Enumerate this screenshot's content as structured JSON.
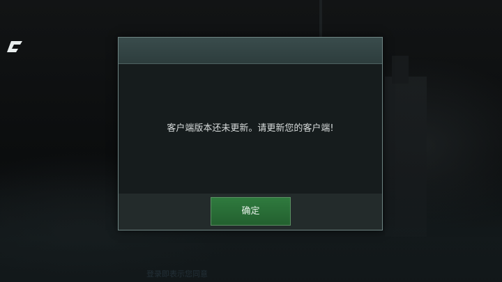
{
  "dialog": {
    "message": "客户端版本还未更新。请更新您的客户端!",
    "confirm_label": "确定"
  },
  "background": {
    "bottom_hint": "登录即表示您同意"
  },
  "icons": {
    "logo": "c-logo-icon"
  },
  "colors": {
    "confirm_button": "#2b6e38",
    "dialog_header": "#34474a",
    "dialog_body": "#161c1d",
    "dialog_border": "#6f8584"
  }
}
